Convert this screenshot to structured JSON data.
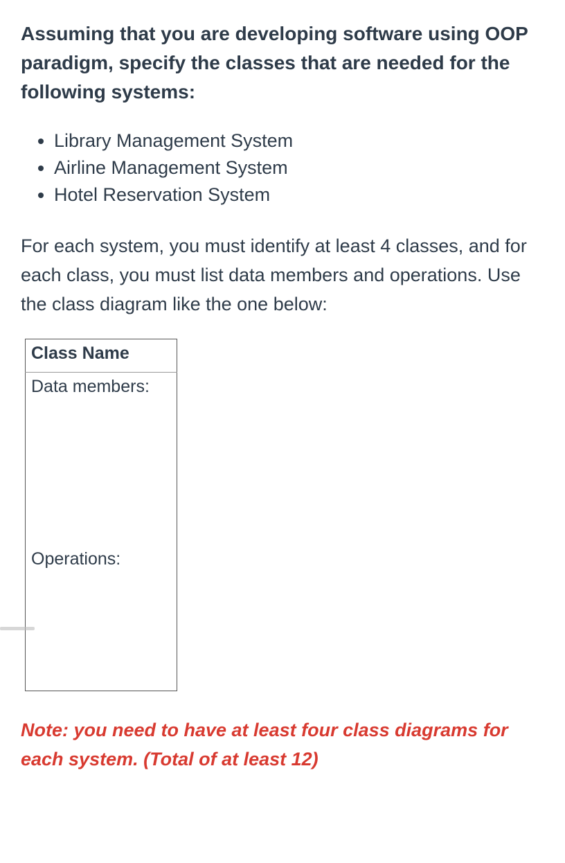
{
  "heading": "Assuming that you are developing software using OOP paradigm, specify the classes that are needed for the following systems:",
  "bullets": {
    "item1": "Library Management System",
    "item2": "Airline Management System",
    "item3": "Hotel Reservation System"
  },
  "paragraph": "For each system, you must identify at least 4 classes, and for each class, you must list data members and operations. Use the class diagram like the one below:",
  "diagram": {
    "class_name_label": "Class Name",
    "data_members_label": "Data members:",
    "operations_label": "Operations:"
  },
  "note": "Note: you need to have at least four class diagrams for each system. (Total of  at least 12)"
}
